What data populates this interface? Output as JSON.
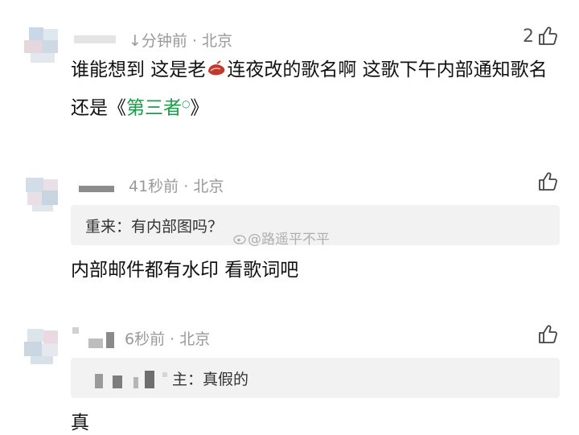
{
  "comments": [
    {
      "time": "↓分钟前",
      "location": "北京",
      "likes": "2",
      "text_before": "谁能想到 这是老",
      "emoji": "meat-emoji",
      "text_after": "连夜改的歌名啊 这歌下午内部通知歌名还是《",
      "song": "第三者",
      "text_end": "》"
    },
    {
      "time": "41秒前",
      "location": "北京",
      "likes": "",
      "quote": "重来：有内部图吗？",
      "text": "内部邮件都有水印 看歌词吧"
    },
    {
      "time": "6秒前",
      "location": "北京",
      "likes": "",
      "quote": "主：真假的",
      "text": "真"
    }
  ],
  "watermark": "@路遥平不平",
  "colors": {
    "link": "#1a9e4a",
    "meta": "#999999",
    "quote_bg": "#f2f2f2"
  },
  "icons": {
    "like": "thumbs-up-icon",
    "search": "search-icon"
  }
}
